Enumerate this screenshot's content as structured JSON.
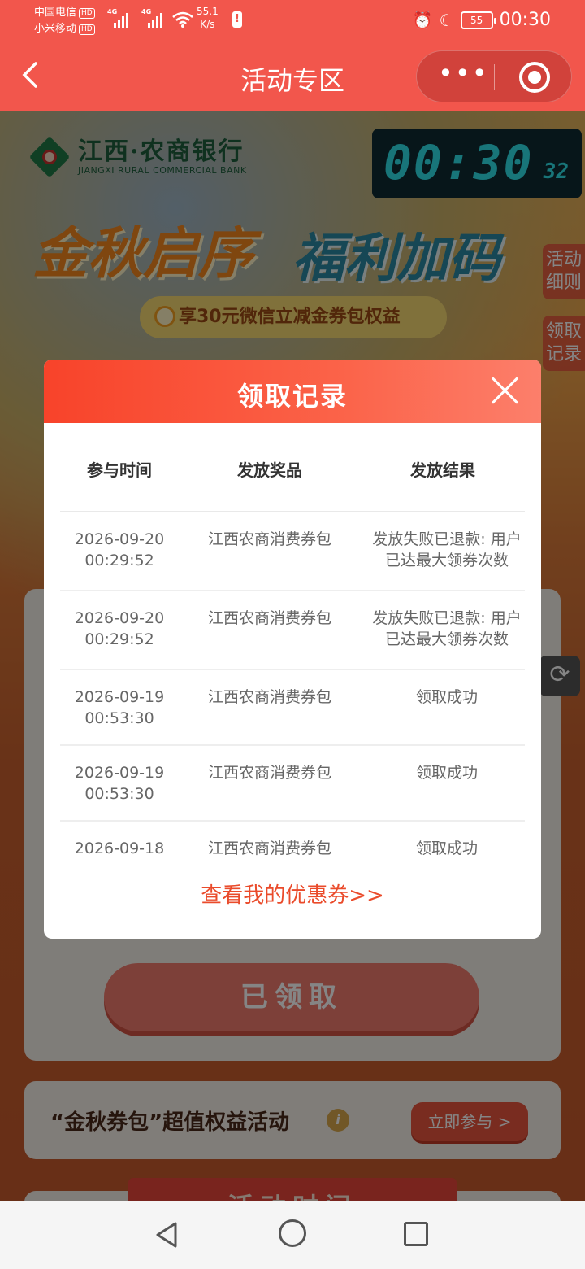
{
  "status_bar": {
    "carrier1": "中国电信",
    "carrier2": "小米移动",
    "hd": "HD",
    "net1": "4G",
    "net2": "4G",
    "speed_value": "55.1",
    "speed_unit": "K/s",
    "battery": "55",
    "time": "00:30"
  },
  "titlebar": {
    "title": "活动专区",
    "more_icon": "more-dots-icon",
    "target_icon": "record-target-icon"
  },
  "banner": {
    "bank_name": "江西·农商银行",
    "bank_en": "JIANGXI RURAL COMMERCIAL BANK",
    "headline_a": "金秋启序",
    "headline_b": "福利加码",
    "subtitle": "享30元微信立减金券包权益"
  },
  "clock": {
    "hm": "00:30",
    "sec": "32"
  },
  "side_tabs": {
    "rules": "活动细则",
    "records": "领取记录"
  },
  "claim_button": "已领取",
  "promo": {
    "text": "“金秋券包”超值权益活动",
    "button": "立即参与 >"
  },
  "activity_time": "活动时间",
  "modal": {
    "title": "领取记录",
    "columns": [
      "参与时间",
      "发放奖品",
      "发放结果"
    ],
    "rows": [
      {
        "date": "2026-09-20",
        "time": "00:29:52",
        "prize": "江西农商消费券包",
        "result": "发放失败已退款: 用户已达最大领券次数"
      },
      {
        "date": "2026-09-20",
        "time": "00:29:52",
        "prize": "江西农商消费券包",
        "result": "发放失败已退款: 用户已达最大领券次数"
      },
      {
        "date": "2026-09-19",
        "time": "00:53:30",
        "prize": "江西农商消费券包",
        "result": "领取成功"
      },
      {
        "date": "2026-09-19",
        "time": "00:53:30",
        "prize": "江西农商消费券包",
        "result": "领取成功"
      },
      {
        "date": "2026-09-18",
        "time": "",
        "prize": "江西农商消费券包",
        "result": "领取成功"
      }
    ],
    "link": "查看我的优惠券>>"
  },
  "colors": {
    "accent": "#f2564c",
    "link": "#ea4b2b",
    "clock": "#2fe0e8"
  }
}
